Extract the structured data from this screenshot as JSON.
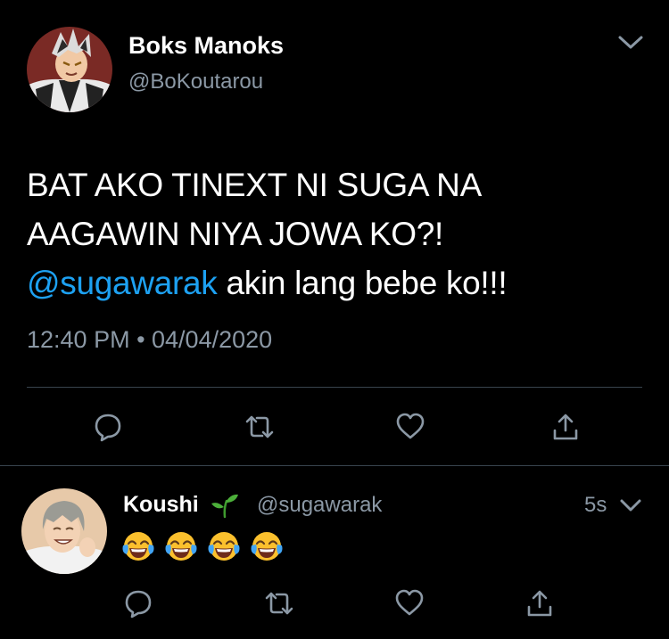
{
  "main_tweet": {
    "name": "Boks Manoks",
    "handle": "@BoKoutarou",
    "text_lines": [
      "BAT AKO TINEXT NI SUGA NA",
      "AAGAWIN NIYA JOWA KO?!"
    ],
    "mention": "@sugawarak",
    "text_after_mention": " akin lang bebe ko!!!",
    "timestamp": "12:40 PM • 04/04/2020",
    "actions": [
      "reply-icon",
      "retweet-icon",
      "like-icon",
      "share-icon"
    ]
  },
  "reply_tweet": {
    "name": "Koushi",
    "name_emoji": "seedling-icon",
    "handle": "@sugawarak",
    "time": "5s",
    "emojis": [
      "face-with-tears-of-joy",
      "face-with-tears-of-joy",
      "face-with-tears-of-joy",
      "face-with-tears-of-joy"
    ],
    "actions": [
      "reply-icon",
      "retweet-icon",
      "like-icon",
      "share-icon"
    ]
  },
  "colors": {
    "background": "#000000",
    "text": "#ffffff",
    "secondary_text": "#8b98a5",
    "mention": "#1da1f2",
    "divider": "#38444d"
  }
}
